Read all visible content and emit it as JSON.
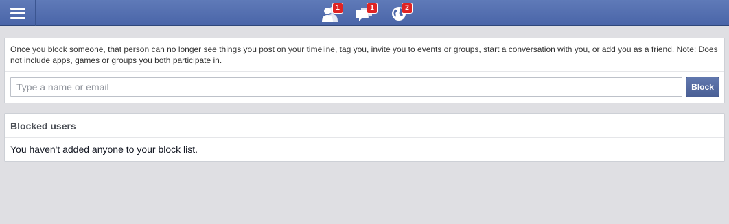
{
  "topbar": {
    "menu_icon": "hamburger-menu-icon",
    "jewels": [
      {
        "icon": "friend-requests-icon",
        "count": "1"
      },
      {
        "icon": "messages-icon",
        "count": "1"
      },
      {
        "icon": "notifications-globe-icon",
        "count": "2"
      }
    ],
    "colors": {
      "bar": "#4a65a8",
      "badge": "#e02424"
    }
  },
  "block_panel": {
    "notice": "Once you block someone, that person can no longer see things you post on your timeline, tag you, invite you to events or groups, start a conversation with you, or add you as a friend. Note: Does not include apps, games or groups you both participate in.",
    "input_placeholder": "Type a name or email",
    "input_value": "",
    "block_label": "Block"
  },
  "blocked_list": {
    "title": "Blocked users",
    "empty_text": "You haven't added anyone to your block list."
  }
}
